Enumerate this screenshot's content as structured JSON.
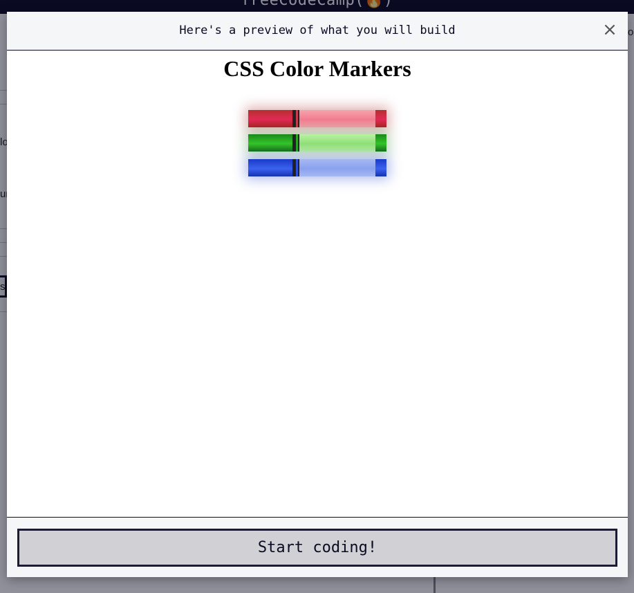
{
  "background": {
    "navbar_logo": "freeCodeCamp(🔥)",
    "left_fragments": [
      "lo",
      "ur",
      "st"
    ],
    "right_fragment": "or"
  },
  "modal": {
    "title": "Here's a preview of what you will build",
    "close_label": "×",
    "preview": {
      "heading": "CSS Color Markers",
      "markers": [
        {
          "name": "red",
          "color": "#e22a55"
        },
        {
          "name": "green",
          "color": "#35c42a"
        },
        {
          "name": "blue",
          "color": "#3b62f0"
        }
      ]
    },
    "start_button_label": "Start coding!"
  },
  "colors": {
    "navbar": "#0a0a23",
    "header_bg": "#f5f6f7",
    "button_bg": "#d0d0d5",
    "button_border": "#1b1b32"
  }
}
